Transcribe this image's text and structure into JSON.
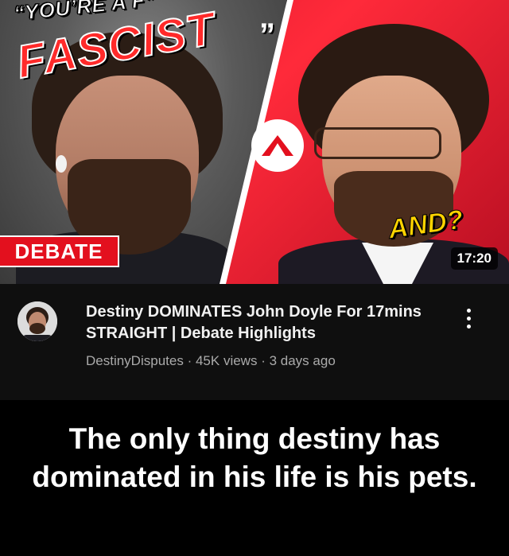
{
  "thumbnail": {
    "quote_line1": "“YOU’RE A F*",
    "quote_line2": "FASCIST",
    "quote_close": "”",
    "badge": "DEBATE",
    "and_text": "AND?",
    "duration": "17:20",
    "colors": {
      "right_bg": "#e3101e",
      "badge_bg": "#e3101e",
      "and_text": "#ffd400"
    }
  },
  "video": {
    "title": "Destiny DOMINATES John Doyle For 17mins STRAIGHT | Debate Highlights",
    "channel": "DestinyDisputes",
    "views": "45K views",
    "age": "3 days ago",
    "separator": "·",
    "menu_icon": "more-vertical-icon"
  },
  "caption": "The only thing destiny has dominated in his life is his pets."
}
